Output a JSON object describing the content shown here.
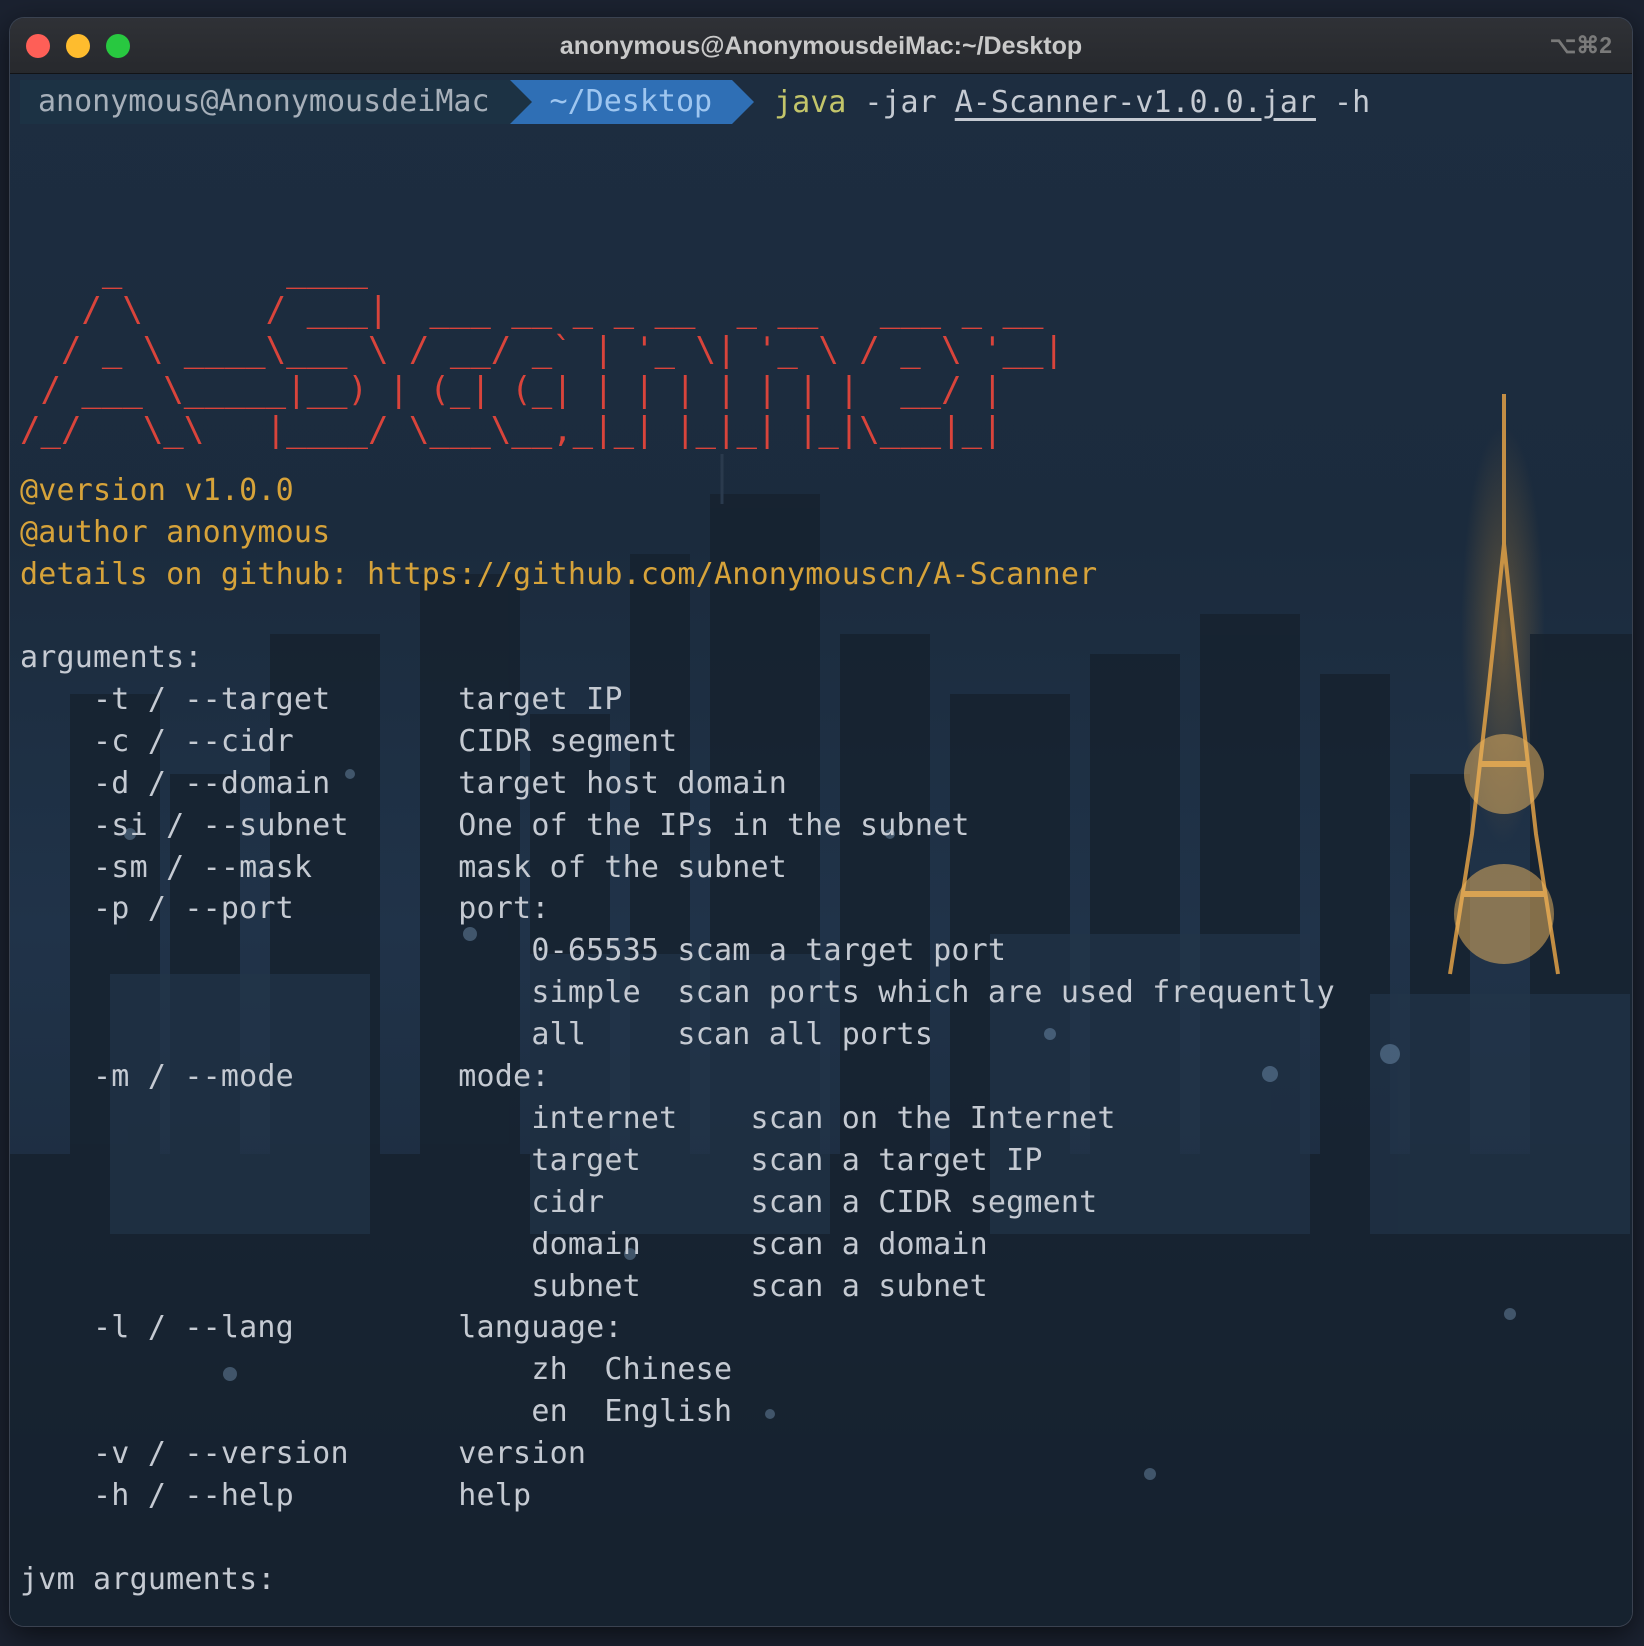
{
  "window": {
    "title": "anonymous@AnonymousdeiMac:~/Desktop",
    "shortcut": "⌥⌘2"
  },
  "prompt": {
    "user_host": "anonymous@AnonymousdeiMac",
    "directory": "~/Desktop",
    "command_exe": "java",
    "command_flag": "-jar",
    "command_file": "A-Scanner-v1.0.0.jar",
    "command_arg": "-h"
  },
  "banner": {
    "ascii_lines": [
      "    _        ____",
      "   / \\      / ___|  ___ __ _ _ __  _ __   ___ _ __",
      "  / _ \\ ____\\___ \\ / __/ _` | '_ \\| '_ \\ / _ \\ '__|",
      " / ___ \\_____|__) | (_| (_| | | | | | | |  __/ |",
      "/_/   \\_\\   |____/ \\___\\__,_|_| |_|_| |_|\\___|_|"
    ],
    "version": "@version v1.0.0",
    "author": "@author anonymous",
    "details": "details on github: https://github.com/Anonymouscn/A-Scanner"
  },
  "help": {
    "lines": [
      "arguments:",
      "    -t / --target       target IP",
      "    -c / --cidr         CIDR segment",
      "    -d / --domain       target host domain",
      "    -si / --subnet      One of the IPs in the subnet",
      "    -sm / --mask        mask of the subnet",
      "    -p / --port         port:",
      "                            0-65535 scam a target port",
      "                            simple  scan ports which are used frequently",
      "                            all     scan all ports",
      "    -m / --mode         mode:",
      "                            internet    scan on the Internet",
      "                            target      scan a target IP",
      "                            cidr        scan a CIDR segment",
      "                            domain      scan a domain",
      "                            subnet      scan a subnet",
      "    -l / --lang         language:",
      "                            zh  Chinese",
      "                            en  English",
      "    -v / --version      version",
      "    -h / --help         help",
      "",
      "jvm arguments:"
    ]
  }
}
